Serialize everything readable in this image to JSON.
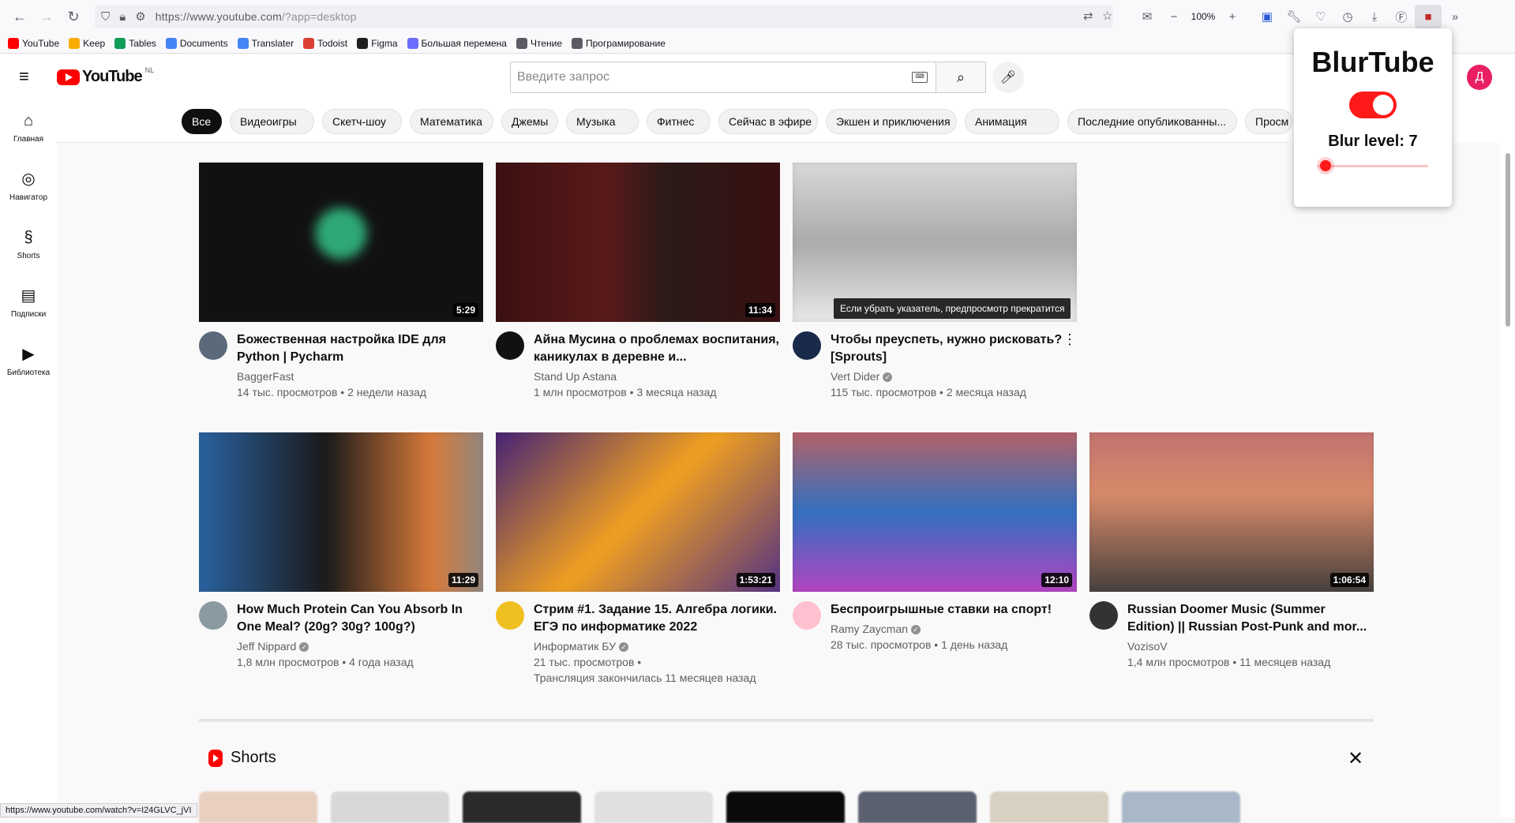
{
  "browser": {
    "url_host": "https://www.youtube.com",
    "url_path": "/?app=desktop",
    "zoom": "100%"
  },
  "bookmarks": [
    {
      "label": "YouTube",
      "color": "#ff0000"
    },
    {
      "label": "Keep",
      "color": "#f9ab00"
    },
    {
      "label": "Tables",
      "color": "#0f9d58"
    },
    {
      "label": "Documents",
      "color": "#4285f4"
    },
    {
      "label": "Translater",
      "color": "#4285f4"
    },
    {
      "label": "Todoist",
      "color": "#db4035"
    },
    {
      "label": "Figma",
      "color": "#1e1e1e"
    },
    {
      "label": "Большая перемена",
      "color": "#6c6cff"
    },
    {
      "label": "Чтение",
      "color": "#5b5b66"
    },
    {
      "label": "Програмирование",
      "color": "#5b5b66"
    }
  ],
  "header": {
    "logo_text": "YouTube",
    "country": "NL",
    "search_placeholder": "Введите запрос",
    "avatar_letter": "Д"
  },
  "guide": [
    {
      "label": "Главная",
      "icon": "home-icon"
    },
    {
      "label": "Навигатор",
      "icon": "compass-icon"
    },
    {
      "label": "Shorts",
      "icon": "shorts-icon"
    },
    {
      "label": "Подписки",
      "icon": "subscriptions-icon"
    },
    {
      "label": "Библиотека",
      "icon": "library-icon"
    }
  ],
  "chips": [
    "Все",
    "Видеоигры",
    "Скетч-шоу",
    "Математика",
    "Джемы",
    "Музыка",
    "Фитнес",
    "Сейчас в эфире",
    "Экшен и приключения",
    "Анимация",
    "Последние опубликованны...",
    "Просм"
  ],
  "videos": [
    {
      "title": "Божественная настройка IDE для Python | Pycharm",
      "channel": "BaggerFast",
      "verified": false,
      "stats": "14 тыс. просмотров • 2 недели назад",
      "stats2": "",
      "duration": "5:29"
    },
    {
      "title": "Айна Мусина о проблемах воспитания, каникулах в деревне и...",
      "channel": "Stand Up Astana",
      "verified": false,
      "stats": "1 млн просмотров • 3 месяца назад",
      "stats2": "",
      "duration": "11:34"
    },
    {
      "title": "Чтобы преуспеть, нужно рисковать? [Sprouts]",
      "channel": "Vert Dider",
      "verified": true,
      "stats": "115 тыс. просмотров • 2 месяца назад",
      "stats2": "",
      "duration": ""
    },
    {
      "title": "How Much Protein Can You Absorb In One Meal? (20g? 30g? 100g?)",
      "channel": "Jeff Nippard",
      "verified": true,
      "stats": "1,8 млн просмотров • 4 года назад",
      "stats2": "",
      "duration": "11:29"
    },
    {
      "title": "Стрим #1. Задание 15. Алгебра логики. ЕГЭ по информатике 2022",
      "channel": "Информатик БУ",
      "verified": true,
      "stats": "21 тыс. просмотров •",
      "stats2": "Трансляция закончилась 11 месяцев назад",
      "duration": "1:53:21"
    },
    {
      "title": "Беспроигрышные ставки на спорт!",
      "channel": "Ramy Zaycman",
      "verified": true,
      "stats": "28 тыс. просмотров • 1 день назад",
      "stats2": "",
      "duration": "12:10"
    },
    {
      "title": "Russian Doomer Music (Summer Edition) || Russian Post-Punk and mor...",
      "channel": "VozisoV",
      "verified": false,
      "stats": "1,4 млн просмотров • 11 месяцев назад",
      "stats2": "",
      "duration": "1:06:54"
    }
  ],
  "tooltip": "Если убрать указатель, предпросмотр прекратится",
  "shorts": {
    "title": "Shorts"
  },
  "status_url": "https://www.youtube.com/watch?v=I24GLVC_jVI",
  "extension": {
    "title": "BlurTube",
    "enabled": true,
    "blur_label": "Blur level: 7",
    "blur_level": 7,
    "blur_max": 100,
    "accent": "#ff1a1a"
  }
}
